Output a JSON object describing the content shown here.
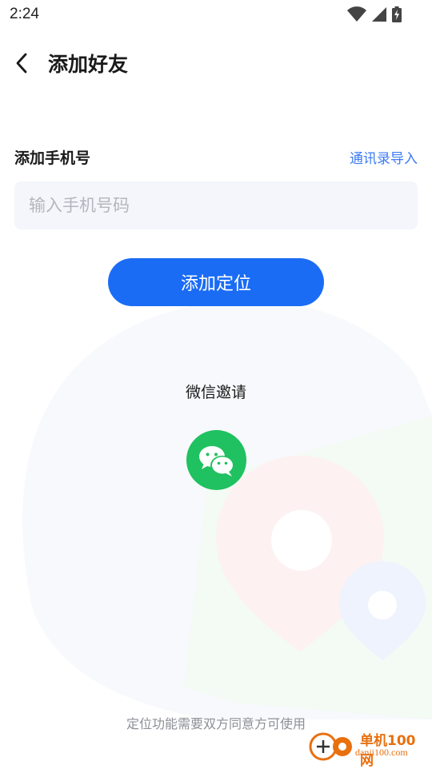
{
  "status_bar": {
    "time": "2:24"
  },
  "header": {
    "title": "添加好友"
  },
  "phone_section": {
    "label": "添加手机号",
    "contacts_link": "通讯录导入",
    "input_placeholder": "输入手机号码",
    "input_value": ""
  },
  "primary_action": {
    "label": "添加定位"
  },
  "invite": {
    "label": "微信邀请",
    "icon": "wechat-icon"
  },
  "footer": {
    "note": "定位功能需要双方同意方可使用"
  },
  "watermark": {
    "name": "单机100网",
    "url": "danji100.com"
  },
  "colors": {
    "primary": "#1a6cf5",
    "link": "#3d7bf2",
    "wechat_green": "#20c160",
    "input_bg": "#f4f6fb"
  }
}
